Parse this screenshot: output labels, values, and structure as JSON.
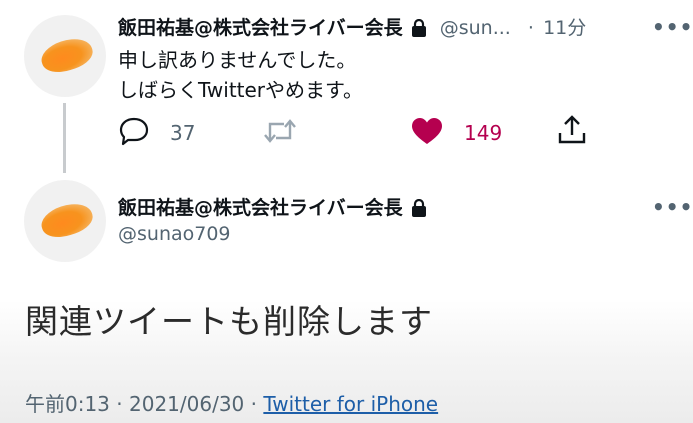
{
  "tweet1": {
    "display_name": "飯田祐基@株式会社ライバー会長",
    "handle_truncated": "@sun...",
    "separator": "·",
    "time_ago": "11分",
    "more": "•••",
    "text_lines": [
      "申し訳ありませんでした。",
      "しばらくTwitterやめます。"
    ],
    "actions": {
      "reply_count": "37",
      "retweet_count": "",
      "like_count": "149"
    }
  },
  "tweet2": {
    "display_name": "飯田祐基@株式会社ライバー会長",
    "handle": "@sunao709",
    "more": "•••",
    "text": "関連ツイートも削除します",
    "time": "午前0:13",
    "date": "2021/06/30",
    "separator": "·",
    "source": "Twitter for iPhone"
  },
  "colors": {
    "like": "#b5004f",
    "secondary": "#536471",
    "link": "#1d5ea8",
    "avatar_accent": "#f7931e"
  },
  "icons": [
    "lock-icon",
    "reply-icon",
    "retweet-icon",
    "heart-icon",
    "share-icon",
    "more-icon"
  ]
}
